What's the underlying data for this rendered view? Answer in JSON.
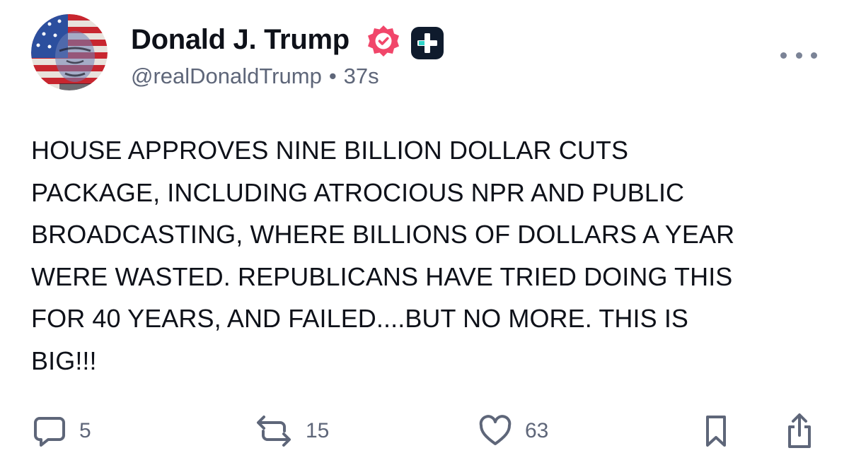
{
  "author": {
    "display_name": "Donald J. Trump",
    "handle": "@realDonaldTrump",
    "separator": "•",
    "timestamp": "37s",
    "verified_color": "#f1466a"
  },
  "post": {
    "lines": [
      "HOUSE APPROVES NINE BILLION DOLLAR CUTS",
      "PACKAGE, INCLUDING ATROCIOUS NPR AND PUBLIC",
      "BROADCASTING, WHERE BILLIONS OF DOLLARS A YEAR",
      "WERE WASTED. REPUBLICANS HAVE TRIED DOING THIS",
      "FOR 40 YEARS, AND FAILED....BUT NO MORE. THIS IS",
      "BIG!!!"
    ]
  },
  "actions": {
    "replies": "5",
    "reposts": "15",
    "likes": "63"
  },
  "icons": {
    "avatar": "flag-portrait-avatar",
    "verified": "verified-badge-icon",
    "plus": "plus-badge-icon",
    "more": "more-options-icon",
    "reply": "reply-icon",
    "repost": "repost-icon",
    "like": "heart-icon",
    "bookmark": "bookmark-icon",
    "share": "share-icon"
  },
  "colors": {
    "text": "#0e1119",
    "muted": "#5e6679",
    "icon": "#5e6679"
  }
}
